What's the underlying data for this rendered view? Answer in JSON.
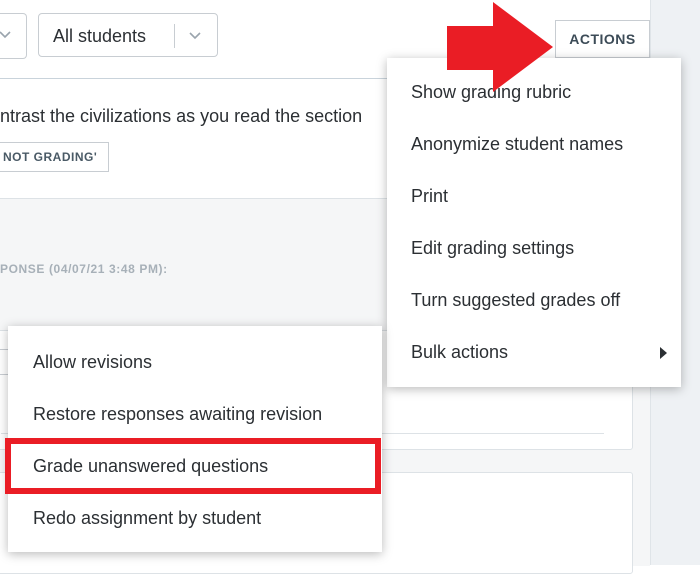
{
  "toolbar": {
    "student_filter": "All students",
    "actions_label": "ACTIONS"
  },
  "assignment": {
    "instruction_fragment": "ntrast the civilizations as you read the section",
    "badge_fragment": "NOT GRADING'",
    "response_label_fragment": "PONSE (04/07/21 3:48 PM):"
  },
  "actions_menu": {
    "items": [
      {
        "label": "Show grading rubric"
      },
      {
        "label": "Anonymize student names"
      },
      {
        "label": "Print"
      },
      {
        "label": "Edit grading settings"
      },
      {
        "label": "Turn suggested grades off"
      },
      {
        "label": "Bulk actions",
        "has_submenu": true
      }
    ]
  },
  "bulk_menu": {
    "items": [
      {
        "label": "Allow revisions"
      },
      {
        "label": "Restore responses awaiting revision"
      },
      {
        "label": "Grade unanswered questions",
        "highlighted": true
      },
      {
        "label": "Redo assignment by student"
      }
    ]
  },
  "annotations": {
    "arrow_color": "#ea1d25",
    "highlight_color": "#ea1d25"
  },
  "icons": {
    "chevron": "chevron-down-icon",
    "submenu": "caret-right-icon"
  }
}
